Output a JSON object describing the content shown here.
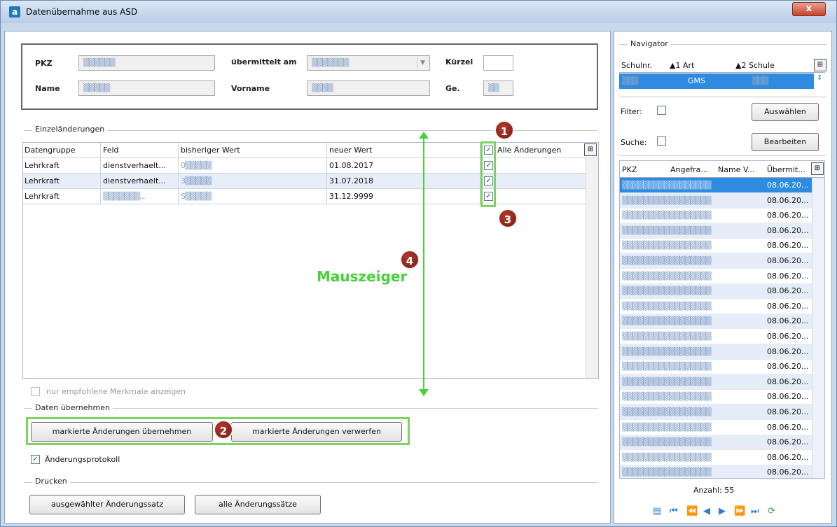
{
  "window": {
    "title": "Datenübernahme aus ASD",
    "close_symbol": "x"
  },
  "person": {
    "pkz_label": "PKZ",
    "pkz_value": "▒▒▒▒▒▒",
    "name_label": "Name",
    "name_value": "▒▒▒▒▒",
    "uebermittelt_label": "übermittelt am",
    "uebermittelt_value": "▒▒▒▒▒▒▒",
    "vorname_label": "Vorname",
    "vorname_value": "▒▒▒▒",
    "kuerzel_label": "Kürzel",
    "kuerzel_value": "",
    "ge_label": "Ge.",
    "ge_value": "▒▒"
  },
  "einzel": {
    "section_label": "Einzeländerungen",
    "columns": [
      "Datengruppe",
      "Feld",
      "bisheriger Wert",
      "neuer Wert",
      "Alle Änderungen"
    ],
    "rows": [
      {
        "gruppe": "Lehrkraft",
        "feld": "dienstverhaelt...",
        "bisher": "0▒▒▒▒▒",
        "neu": "01.08.2017",
        "checked": "✓"
      },
      {
        "gruppe": "Lehrkraft",
        "feld": "dienstverhaelt...",
        "bisher": "3▒▒▒▒▒",
        "neu": "31.07.2018",
        "checked": "✓"
      },
      {
        "gruppe": "Lehrkraft",
        "feld": "▒▒▒▒▒▒▒...",
        "bisher": "S▒▒▒▒▒",
        "neu": "31.12.9999",
        "checked": "✓"
      }
    ],
    "header_check": "✓",
    "empfohlen_label": "nur empfohlene Merkmale anzeigen"
  },
  "annotations": {
    "badge1": "1",
    "badge2": "2",
    "badge3": "3",
    "badge4": "4",
    "mouse_label": "Mauszeiger",
    "accent_green": "#48d13a",
    "badge_red": "#8e2219"
  },
  "uebernehmen": {
    "section_label": "Daten übernehmen",
    "btn_apply": "markierte Änderungen übernehmen",
    "btn_discard": "markierte Änderungen verwerfen",
    "protokoll_label": "Änderungsprotokoll",
    "protokoll_check": "✓"
  },
  "drucken": {
    "section_label": "Drucken",
    "btn_selected": "ausgewählter Änderungssatz",
    "btn_all": "alle Änderungssätze"
  },
  "navigator": {
    "title": "Navigator",
    "columns": [
      "Schulnr.",
      "▲1 Art",
      "▲2 Schule"
    ],
    "row": {
      "schulnr": "▒▒▒",
      "art": "GMS",
      "schule": "▒▒▒"
    },
    "filter_label": "Filter:",
    "suche_label": "Suche:",
    "auswaehlen_btn": "Auswählen",
    "bearbeiten_btn": "Bearbeiten",
    "list_columns": [
      "PKZ",
      "Angefra...",
      "Name V...",
      "Übermit..."
    ],
    "list_rows": [
      "08.06.20...",
      "08.06.20...",
      "08.06.20...",
      "08.06.20...",
      "08.06.20...",
      "08.06.20...",
      "08.06.20...",
      "08.06.20...",
      "08.06.20...",
      "08.06.20...",
      "08.06.20...",
      "08.06.20...",
      "08.06.20...",
      "08.06.20...",
      "08.06.20...",
      "08.06.20...",
      "08.06.20...",
      "08.06.20...",
      "08.06.20...",
      "08.06.20..."
    ],
    "anzahl": "Anzahl: 55"
  }
}
